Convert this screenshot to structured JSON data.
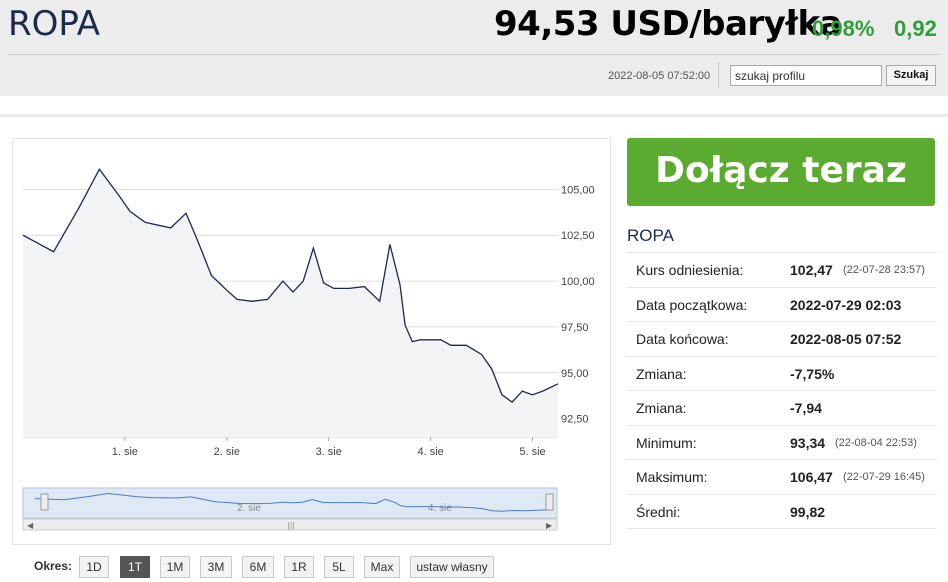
{
  "header": {
    "title": "ROPA",
    "price": "94,53 USD/baryłka",
    "change_pct": "0,98%",
    "change_abs": "0,92",
    "timestamp": "2022-08-05 07:52:00",
    "search_placeholder": "szukaj profilu",
    "search_button": "Szukaj"
  },
  "cta": {
    "label": "Dołącz teraz"
  },
  "info": {
    "title": "ROPA",
    "rows": [
      {
        "label": "Kurs odniesienia:",
        "value": "102,47",
        "detail": "(22-07-28 23:57)"
      },
      {
        "label": "Data początkowa:",
        "value": "2022-07-29 02:03",
        "detail": ""
      },
      {
        "label": "Data końcowa:",
        "value": "2022-08-05 07:52",
        "detail": ""
      },
      {
        "label": "Zmiana:",
        "value": "-7,75%",
        "detail": ""
      },
      {
        "label": "Zmiana:",
        "value": "-7,94",
        "detail": ""
      },
      {
        "label": "Minimum:",
        "value": "93,34",
        "detail": "(22-08-04 22:53)"
      },
      {
        "label": "Maksimum:",
        "value": "106,47",
        "detail": "(22-07-29 16:45)"
      },
      {
        "label": "Średni:",
        "value": "99,82",
        "detail": ""
      }
    ]
  },
  "periods": {
    "label": "Okres:",
    "buttons": [
      "1D",
      "1T",
      "1M",
      "3M",
      "6M",
      "1R",
      "5L",
      "Max",
      "ustaw własny"
    ],
    "active": "1T"
  },
  "colors": {
    "accent": "#5cab31",
    "positive": "#2e9e3a",
    "line": "#1b2a4a",
    "navigator": "#4a7cc7"
  },
  "chart_data": {
    "type": "area",
    "ylim": [
      91.5,
      107.2
    ],
    "y_ticks": [
      "105,00",
      "102,50",
      "100,00",
      "97,50",
      "95,00",
      "92,50"
    ],
    "x_ticks": [
      "1. sie",
      "2. sie",
      "3. sie",
      "4. sie",
      "5. sie"
    ],
    "navigator_ticks": [
      "2. sie",
      "4. sie"
    ],
    "x": [
      0,
      0.3,
      0.55,
      0.75,
      0.95,
      1.05,
      1.2,
      1.45,
      1.6,
      1.7,
      1.75,
      1.85,
      2.0,
      2.1,
      2.25,
      2.4,
      2.55,
      2.65,
      2.75,
      2.85,
      2.95,
      3.05,
      3.2,
      3.35,
      3.5,
      3.6,
      3.7,
      3.75,
      3.82,
      3.9,
      4.0,
      4.1,
      4.2,
      4.35,
      4.5,
      4.6,
      4.7,
      4.8,
      4.9,
      5.0,
      5.1,
      5.25
    ],
    "values": [
      102.5,
      101.6,
      104.0,
      106.1,
      104.6,
      103.8,
      103.2,
      102.9,
      103.7,
      102.4,
      101.7,
      100.3,
      99.5,
      99.0,
      98.9,
      99.0,
      100.0,
      99.4,
      100.0,
      101.8,
      99.9,
      99.6,
      99.6,
      99.7,
      98.9,
      102.0,
      99.8,
      97.6,
      96.7,
      96.8,
      96.8,
      96.8,
      96.5,
      96.5,
      96.0,
      95.2,
      93.8,
      93.4,
      94.0,
      93.8,
      94.0,
      94.4
    ]
  }
}
